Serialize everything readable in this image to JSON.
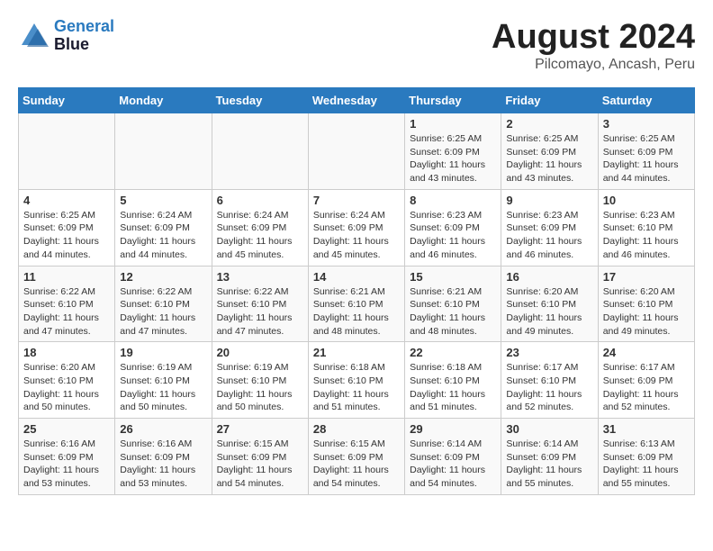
{
  "header": {
    "logo_line1": "General",
    "logo_line2": "Blue",
    "title": "August 2024",
    "subtitle": "Pilcomayo, Ancash, Peru"
  },
  "calendar": {
    "weekdays": [
      "Sunday",
      "Monday",
      "Tuesday",
      "Wednesday",
      "Thursday",
      "Friday",
      "Saturday"
    ],
    "weeks": [
      [
        {
          "day": "",
          "info": ""
        },
        {
          "day": "",
          "info": ""
        },
        {
          "day": "",
          "info": ""
        },
        {
          "day": "",
          "info": ""
        },
        {
          "day": "1",
          "info": "Sunrise: 6:25 AM\nSunset: 6:09 PM\nDaylight: 11 hours\nand 43 minutes."
        },
        {
          "day": "2",
          "info": "Sunrise: 6:25 AM\nSunset: 6:09 PM\nDaylight: 11 hours\nand 43 minutes."
        },
        {
          "day": "3",
          "info": "Sunrise: 6:25 AM\nSunset: 6:09 PM\nDaylight: 11 hours\nand 44 minutes."
        }
      ],
      [
        {
          "day": "4",
          "info": "Sunrise: 6:25 AM\nSunset: 6:09 PM\nDaylight: 11 hours\nand 44 minutes."
        },
        {
          "day": "5",
          "info": "Sunrise: 6:24 AM\nSunset: 6:09 PM\nDaylight: 11 hours\nand 44 minutes."
        },
        {
          "day": "6",
          "info": "Sunrise: 6:24 AM\nSunset: 6:09 PM\nDaylight: 11 hours\nand 45 minutes."
        },
        {
          "day": "7",
          "info": "Sunrise: 6:24 AM\nSunset: 6:09 PM\nDaylight: 11 hours\nand 45 minutes."
        },
        {
          "day": "8",
          "info": "Sunrise: 6:23 AM\nSunset: 6:09 PM\nDaylight: 11 hours\nand 46 minutes."
        },
        {
          "day": "9",
          "info": "Sunrise: 6:23 AM\nSunset: 6:09 PM\nDaylight: 11 hours\nand 46 minutes."
        },
        {
          "day": "10",
          "info": "Sunrise: 6:23 AM\nSunset: 6:10 PM\nDaylight: 11 hours\nand 46 minutes."
        }
      ],
      [
        {
          "day": "11",
          "info": "Sunrise: 6:22 AM\nSunset: 6:10 PM\nDaylight: 11 hours\nand 47 minutes."
        },
        {
          "day": "12",
          "info": "Sunrise: 6:22 AM\nSunset: 6:10 PM\nDaylight: 11 hours\nand 47 minutes."
        },
        {
          "day": "13",
          "info": "Sunrise: 6:22 AM\nSunset: 6:10 PM\nDaylight: 11 hours\nand 47 minutes."
        },
        {
          "day": "14",
          "info": "Sunrise: 6:21 AM\nSunset: 6:10 PM\nDaylight: 11 hours\nand 48 minutes."
        },
        {
          "day": "15",
          "info": "Sunrise: 6:21 AM\nSunset: 6:10 PM\nDaylight: 11 hours\nand 48 minutes."
        },
        {
          "day": "16",
          "info": "Sunrise: 6:20 AM\nSunset: 6:10 PM\nDaylight: 11 hours\nand 49 minutes."
        },
        {
          "day": "17",
          "info": "Sunrise: 6:20 AM\nSunset: 6:10 PM\nDaylight: 11 hours\nand 49 minutes."
        }
      ],
      [
        {
          "day": "18",
          "info": "Sunrise: 6:20 AM\nSunset: 6:10 PM\nDaylight: 11 hours\nand 50 minutes."
        },
        {
          "day": "19",
          "info": "Sunrise: 6:19 AM\nSunset: 6:10 PM\nDaylight: 11 hours\nand 50 minutes."
        },
        {
          "day": "20",
          "info": "Sunrise: 6:19 AM\nSunset: 6:10 PM\nDaylight: 11 hours\nand 50 minutes."
        },
        {
          "day": "21",
          "info": "Sunrise: 6:18 AM\nSunset: 6:10 PM\nDaylight: 11 hours\nand 51 minutes."
        },
        {
          "day": "22",
          "info": "Sunrise: 6:18 AM\nSunset: 6:10 PM\nDaylight: 11 hours\nand 51 minutes."
        },
        {
          "day": "23",
          "info": "Sunrise: 6:17 AM\nSunset: 6:10 PM\nDaylight: 11 hours\nand 52 minutes."
        },
        {
          "day": "24",
          "info": "Sunrise: 6:17 AM\nSunset: 6:09 PM\nDaylight: 11 hours\nand 52 minutes."
        }
      ],
      [
        {
          "day": "25",
          "info": "Sunrise: 6:16 AM\nSunset: 6:09 PM\nDaylight: 11 hours\nand 53 minutes."
        },
        {
          "day": "26",
          "info": "Sunrise: 6:16 AM\nSunset: 6:09 PM\nDaylight: 11 hours\nand 53 minutes."
        },
        {
          "day": "27",
          "info": "Sunrise: 6:15 AM\nSunset: 6:09 PM\nDaylight: 11 hours\nand 54 minutes."
        },
        {
          "day": "28",
          "info": "Sunrise: 6:15 AM\nSunset: 6:09 PM\nDaylight: 11 hours\nand 54 minutes."
        },
        {
          "day": "29",
          "info": "Sunrise: 6:14 AM\nSunset: 6:09 PM\nDaylight: 11 hours\nand 54 minutes."
        },
        {
          "day": "30",
          "info": "Sunrise: 6:14 AM\nSunset: 6:09 PM\nDaylight: 11 hours\nand 55 minutes."
        },
        {
          "day": "31",
          "info": "Sunrise: 6:13 AM\nSunset: 6:09 PM\nDaylight: 11 hours\nand 55 minutes."
        }
      ]
    ]
  }
}
